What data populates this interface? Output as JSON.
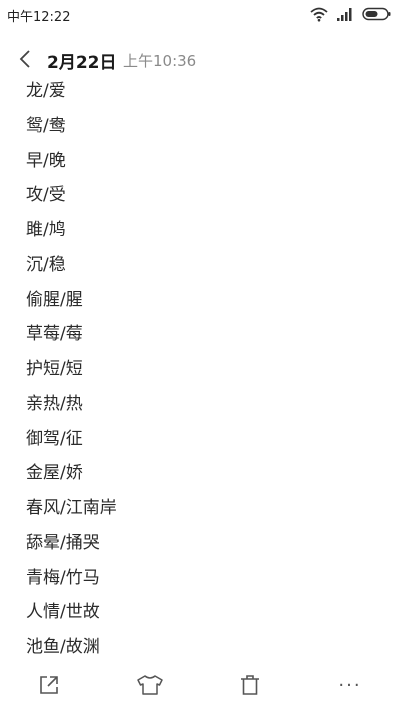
{
  "status_bar": {
    "time": "中午12:22",
    "icons": [
      "wifi-icon",
      "signal-icon",
      "battery-icon"
    ]
  },
  "header": {
    "date": "2月22日",
    "time": "上午10:36"
  },
  "note": {
    "lines": [
      "龙/爱",
      "鸳/鸯",
      "早/晚",
      "攻/受",
      "雎/鸠",
      "沉/稳",
      "偷腥/腥",
      "草莓/莓",
      "护短/短",
      "亲热/热",
      "御驾/征",
      "金屋/娇",
      "春风/江南岸",
      "舔晕/捅哭",
      "青梅/竹马",
      "人情/世故",
      "池鱼/故渊"
    ]
  },
  "toolbar": {
    "icons": [
      "share-icon",
      "theme-icon",
      "delete-icon",
      "more-icon"
    ],
    "more_label": "···"
  },
  "colors": {
    "background": "#ffffff",
    "text": "#2b2b2b",
    "muted": "#8a8a8a"
  }
}
